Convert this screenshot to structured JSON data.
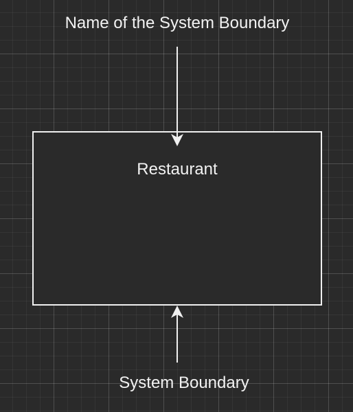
{
  "diagram": {
    "top_annotation": "Name of the System Boundary",
    "bottom_annotation": "System Boundary",
    "boundary": {
      "name": "Restaurant"
    }
  },
  "colors": {
    "background": "#2a2a2a",
    "stroke": "#f0f0f0",
    "text": "#f2f2f2"
  }
}
